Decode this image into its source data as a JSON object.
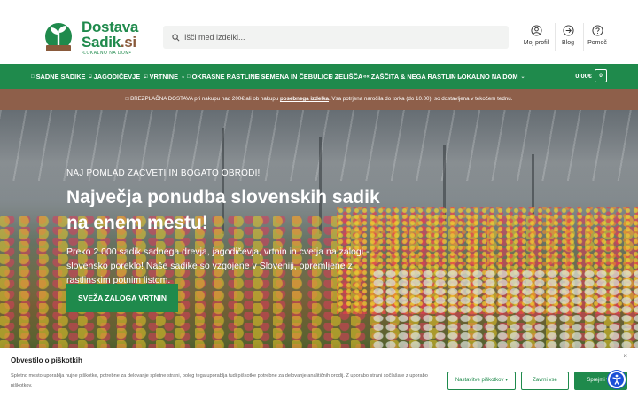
{
  "header": {
    "logo": {
      "line1": "Dostava",
      "line2": "Sadik",
      "line2_suffix": ".si",
      "tagline": "•LOKALNO NA DOM•"
    },
    "search": {
      "placeholder": "Išči med izdelki..."
    },
    "icons": [
      {
        "label": "Moj profil",
        "icon": "user-icon"
      },
      {
        "label": "Blog",
        "icon": "arrow-right-circle-icon"
      },
      {
        "label": "Pomoč",
        "icon": "help-icon"
      }
    ]
  },
  "nav": {
    "items": [
      {
        "label": "SADNE SADIKE",
        "prefix": "□"
      },
      {
        "label": "JAGODIČEVJE",
        "prefix": "□"
      },
      {
        "label": "VRTNINE",
        "prefix": "□"
      },
      {
        "label": "OKRASNE RASTLINE",
        "prefix": "□"
      },
      {
        "label": "SEMENA IN ČEBULICE",
        "prefix": "□"
      },
      {
        "label": "ZELIŠČA",
        "prefix": "□"
      },
      {
        "label": "ZAŠČITA & NEGA RASTLIN",
        "prefix": "««"
      },
      {
        "label": "LOKALNO NA DOM",
        "prefix": "□□"
      }
    ],
    "cart_total": "0.00€",
    "cart_count": "0"
  },
  "promo": {
    "prefix": "□ BREZPLAČNA DOSTAVA pri nakupu nad 200€ ali ob nakupu ",
    "link": "posebnega izdelka",
    "suffix": ". Vsa potrjena naročila do torka (do 10.00), so dostavljena v tekočem tednu."
  },
  "hero": {
    "eyebrow": "NAJ POMLAD ZACVETI IN BOGATO OBRODI!",
    "title": "Največja ponudba slovenskih sadik na enem mestu!",
    "subtitle": "Preko 2.000 sadik sadnega drevja, jagodičevja, vrtnin in cvetja na zalogi - slovensko poreklo! Naše sadike so vzgojene v Sloveniji, opremljene z rastlinskim potnim listom.",
    "button": "SVEŽA ZALOGA VRTNIN"
  },
  "cookie": {
    "title": "Obvestilo o piškotkih",
    "text": "Spletno mesto uporablja nujne piškotke, potrebne za delovanje spletne strani, poleg tega uporablja tudi piškotke potrebne za delovanje analitičnih orodij. Z uporabo strani sočlašate z uporabo piškotkov.",
    "settings": "Nastavitve piškotkov ▾",
    "reject": "Zavrni vse",
    "accept": "Sprejmi vse",
    "close": "×"
  }
}
